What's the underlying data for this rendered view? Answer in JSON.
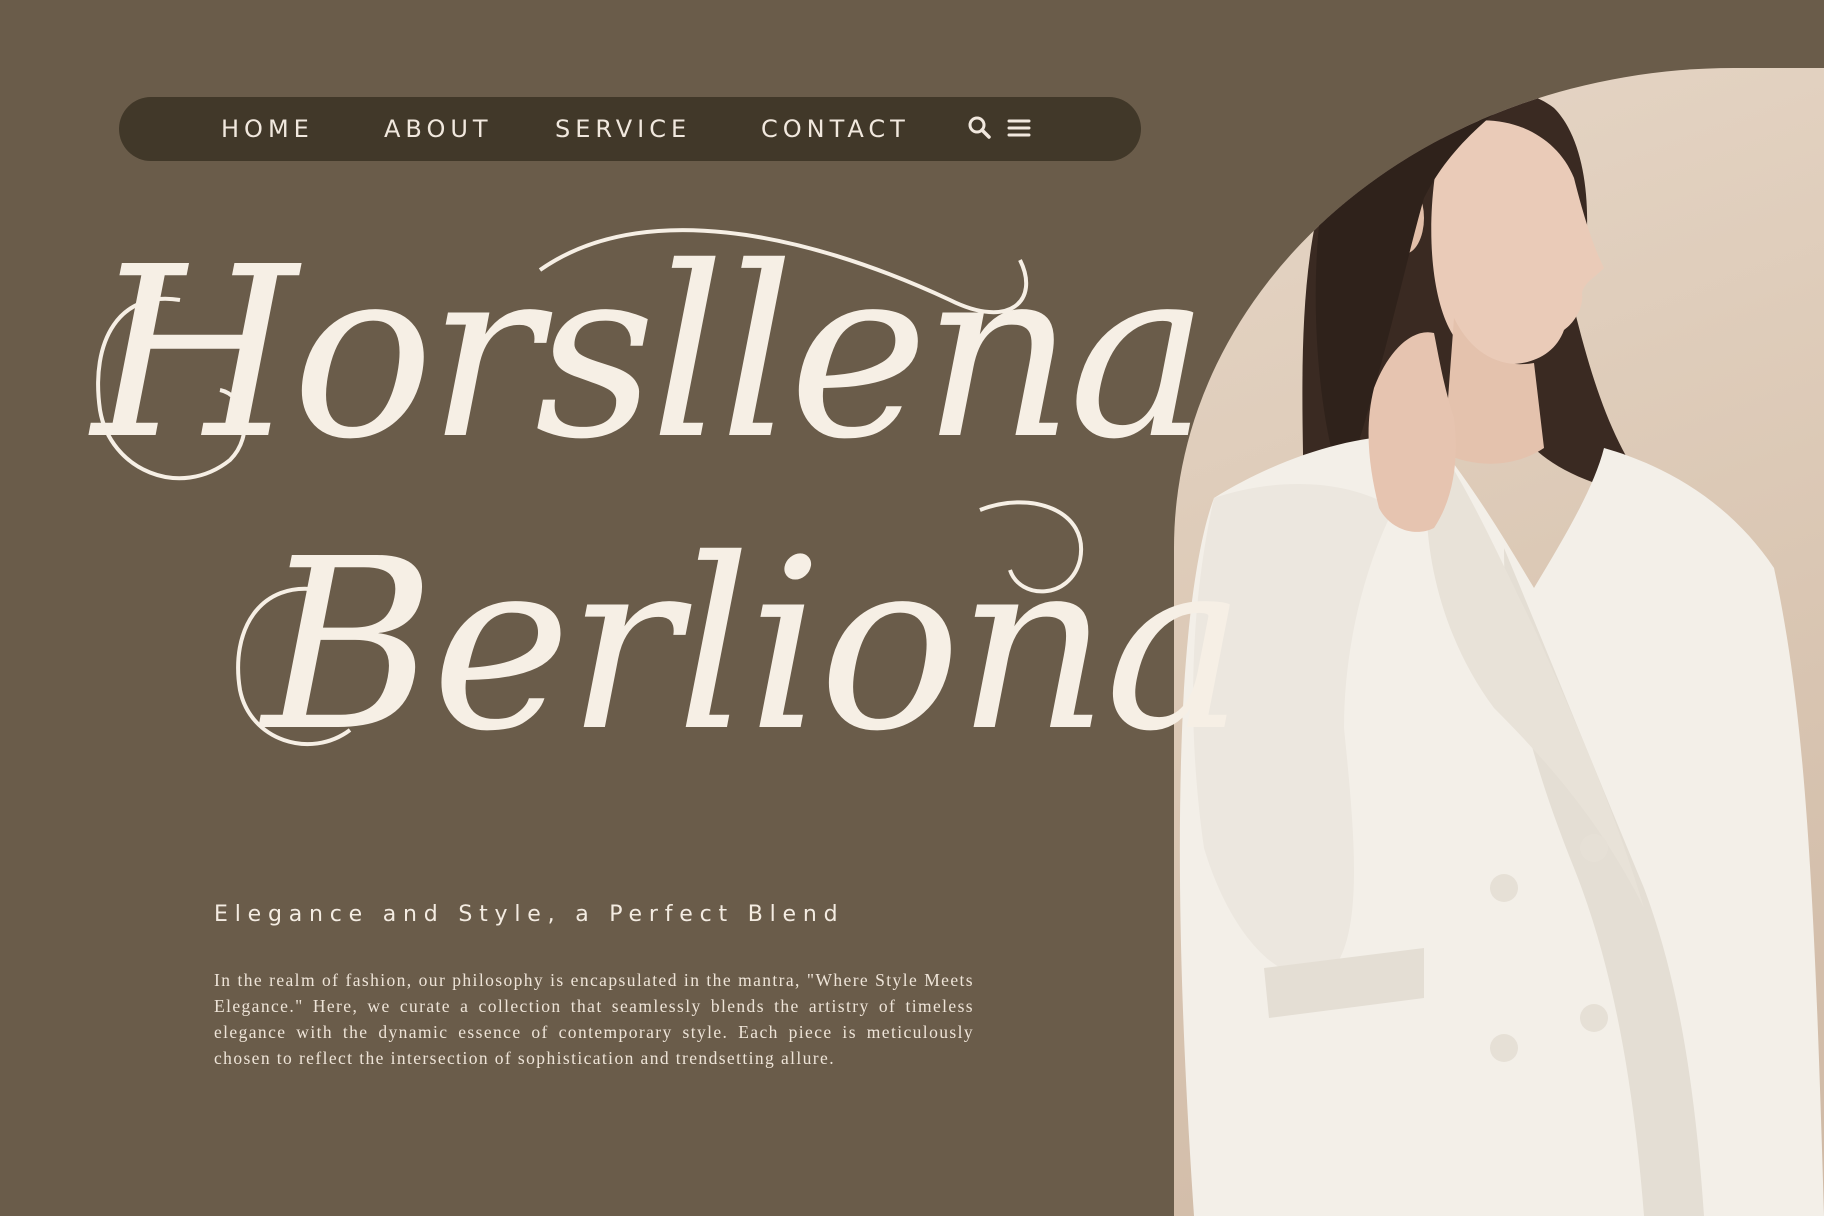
{
  "nav": {
    "items": [
      {
        "label": "HOME"
      },
      {
        "label": "ABOUT"
      },
      {
        "label": "SERVICE"
      },
      {
        "label": "CONTACT"
      }
    ],
    "icons": [
      "search-icon",
      "menu-icon"
    ]
  },
  "hero": {
    "title_line1": "Horsllena",
    "title_line2": "Berliona",
    "tagline": "Elegance and Style, a Perfect Blend",
    "paragraph": "In the realm of fashion, our philosophy is encapsulated in the mantra, \"Where Style Meets Elegance.\" Here, we curate a collection that seamlessly blends the artistry of timeless elegance with the dynamic essence of contemporary style. Each piece is meticulously chosen to reflect the intersection of sophistication and trendsetting allure."
  },
  "colors": {
    "background": "#6a5c4a",
    "nav_background": "#413829",
    "text_light": "#f6efe5",
    "photo_wall": "#e0cfbd",
    "blazer": "#f3efe8",
    "hair": "#3a2a22"
  }
}
